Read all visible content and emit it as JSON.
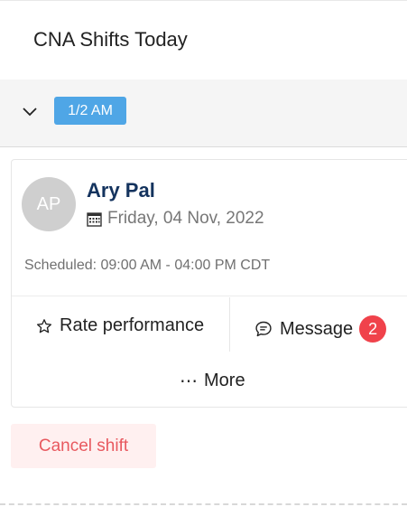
{
  "page": {
    "title": "CNA Shifts Today"
  },
  "group": {
    "badge": "1/2 AM"
  },
  "shift": {
    "avatar_initials": "AP",
    "name": "Ary Pal",
    "date": "Friday, 04 Nov, 2022",
    "scheduled": "Scheduled: 09:00 AM - 04:00 PM CDT"
  },
  "actions": {
    "rate_label": "Rate performance",
    "message_label": "Message",
    "message_count": "2",
    "more_label": "More"
  },
  "cancel": {
    "label": "Cancel shift"
  },
  "colors": {
    "badge": "#4fa6e6",
    "name": "#14335e",
    "message_badge": "#f0424b",
    "cancel_text": "#e8595f",
    "cancel_bg": "#fff0f0"
  },
  "icons": [
    "chevron-down-icon",
    "calendar-icon",
    "star-icon",
    "chat-bubble-icon",
    "more-dots-icon"
  ]
}
